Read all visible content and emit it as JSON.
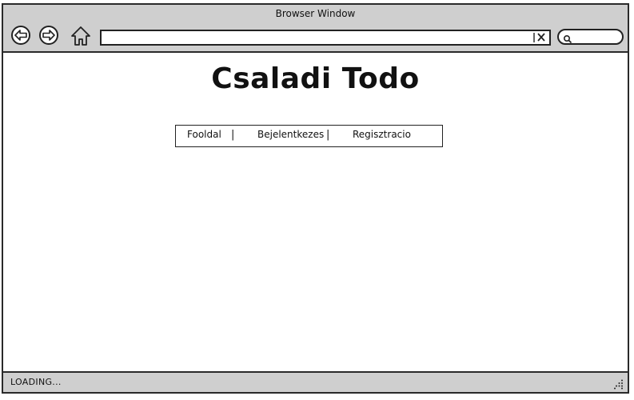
{
  "window": {
    "title": "Browser Window"
  },
  "toolbar": {
    "back_icon": "back-arrow-icon",
    "forward_icon": "forward-arrow-icon",
    "home_icon": "home-icon",
    "address_value": "",
    "clear_icon": "clear-icon",
    "search_icon": "search-icon",
    "search_value": ""
  },
  "page": {
    "title": "Csaladi Todo",
    "menu": [
      {
        "label": "Fooldal"
      },
      {
        "label": "Bejelentkezes"
      },
      {
        "label": "Regisztracio"
      }
    ],
    "separator": "|"
  },
  "status": {
    "text": "LOADING...",
    "grip_icon": "resize-grip-icon"
  },
  "colors": {
    "chrome_bg": "#cfcfcf",
    "border": "#2a2a2a",
    "content_bg": "#ffffff",
    "text": "#111111"
  }
}
